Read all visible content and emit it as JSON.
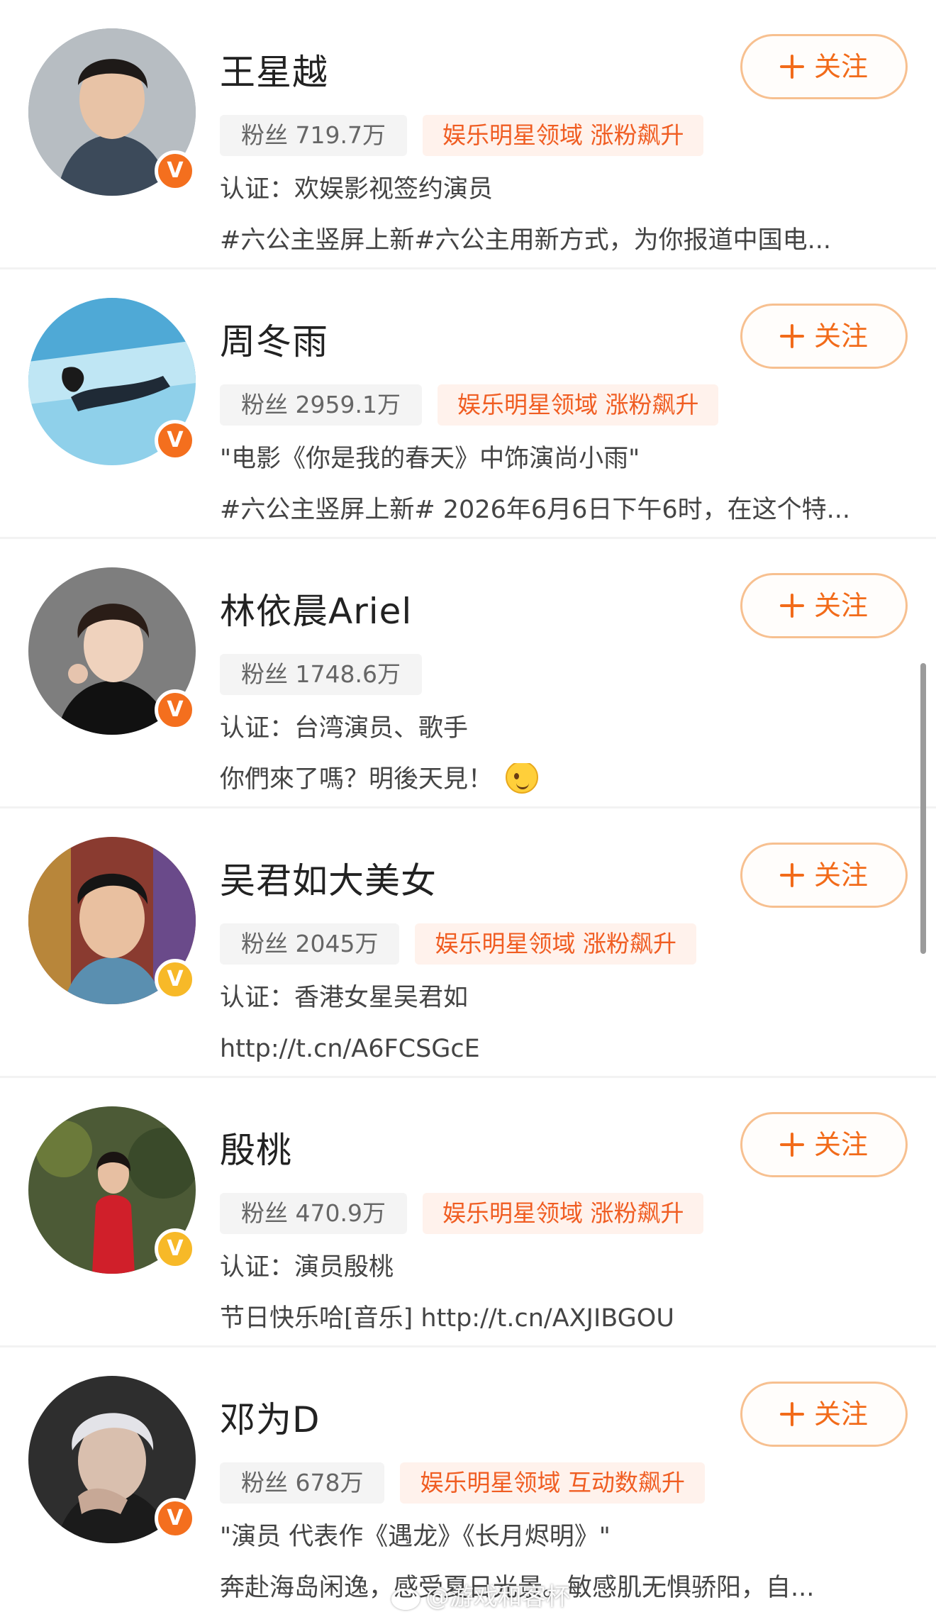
{
  "follow_label": "关注",
  "fans_prefix": "粉丝",
  "users": [
    {
      "name": "王星越",
      "fans": "粉丝 719.7万",
      "hot_tag": "娱乐明星领域 涨粉飙升",
      "line1": "认证：欢娱影视签约演员",
      "line2": "#六公主竖屏上新#六公主用新方式，为你报道中国电...",
      "verified_color": "#f46f1e",
      "avatar_bg": "#6d7c8a",
      "avatar_icon": "portrait-photo"
    },
    {
      "name": "周冬雨",
      "fans": "粉丝 2959.1万",
      "hot_tag": "娱乐明星领域 涨粉飙升",
      "line1": "\"电影《你是我的春天》中饰演尚小雨\"",
      "line2": "#六公主竖屏上新# 2026年6月6日下午6时，在这个特...",
      "verified_color": "#f46f1e",
      "avatar_bg": "#5fb6d9",
      "avatar_icon": "underwater-photo"
    },
    {
      "name": "林依晨Ariel",
      "fans": "粉丝 1748.6万",
      "hot_tag": "",
      "line1": "认证：台湾演员、歌手",
      "line2": "你們來了嗎？明後天見！",
      "verified_color": "#f46f1e",
      "avatar_bg": "#8b8b8b",
      "avatar_icon": "portrait-photo"
    },
    {
      "name": "吴君如大美女",
      "fans": "粉丝 2045万",
      "hot_tag": "娱乐明星领域 涨粉飙升",
      "line1": "认证：香港女星吴君如",
      "line2": "http://t.cn/A6FCSGcE",
      "verified_color": "#f7b928",
      "avatar_bg": "#a4473a",
      "avatar_icon": "portrait-photo"
    },
    {
      "name": "殷桃",
      "fans": "粉丝 470.9万",
      "hot_tag": "娱乐明星领域 涨粉飙升",
      "line1": "认证：演员殷桃",
      "line2": "节日快乐哈[音乐] http://t.cn/AXJIBGOU",
      "verified_color": "#f7b928",
      "avatar_bg": "#4a5a3a",
      "avatar_icon": "portrait-photo"
    },
    {
      "name": "邓为D",
      "fans": "粉丝 678万",
      "hot_tag": "娱乐明星领域 互动数飙升",
      "line1": "\"演员 代表作《遇龙》《长月烬明》\"",
      "line2": "奔赴海岛闲逸，感受夏日光景。敏感肌无惧骄阳，自...",
      "verified_color": "#f46f1e",
      "avatar_bg": "#3b3b3b",
      "avatar_icon": "portrait-photo"
    }
  ],
  "watermark": "@游戏和客杯"
}
